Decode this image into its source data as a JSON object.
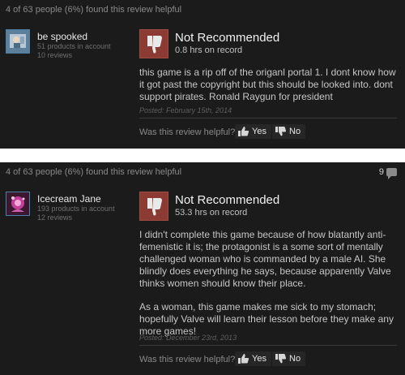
{
  "reviews": [
    {
      "found_helpful": "4 of 63 people (6%) found this review helpful",
      "comment_count": "",
      "username": "be spooked",
      "products": "51 products in account",
      "reviews_count": "10 reviews",
      "verdict": "Not Recommended",
      "hours": "0.8 hrs on record",
      "paragraphs": [
        "this game is a rip off of the origanl portal 1. I dont know how it got past the copyright but this should be looked into. dont support pirates. Ronald Raygun for president"
      ],
      "posted": "Posted: February 15th, 2014",
      "helpful_question": "Was this review helpful?",
      "yes_label": "Yes",
      "no_label": "No"
    },
    {
      "found_helpful": "4 of 63 people (6%) found this review helpful",
      "comment_count": "9",
      "username": "Icecream Jane",
      "products": "193 products in account",
      "reviews_count": "12 reviews",
      "verdict": "Not Recommended",
      "hours": "53.3 hrs on record",
      "paragraphs": [
        "I didn't complete this game because of how blatantly anti-femenistic it is; the protagonist is a some sort of mentally challenged woman who is commanded by a male AI. She blindly does everything he says, because apparently Valve thinks women should know their place.",
        "As a woman, this game makes me sick to my stomach; hopefully Valve will learn their lesson before they make any more games!"
      ],
      "posted": "Posted: December 23rd, 2013",
      "helpful_question": "Was this review helpful?",
      "yes_label": "Yes",
      "no_label": "No"
    }
  ],
  "icons": {
    "thumb": "thumbs-down-icon",
    "yes": "thumbs-up-icon",
    "no": "thumbs-down-small-icon",
    "comments": "comment-bubble-icon"
  },
  "colors": {
    "panel": "#1b1b1b",
    "thumb_box": "#8b3b33"
  }
}
